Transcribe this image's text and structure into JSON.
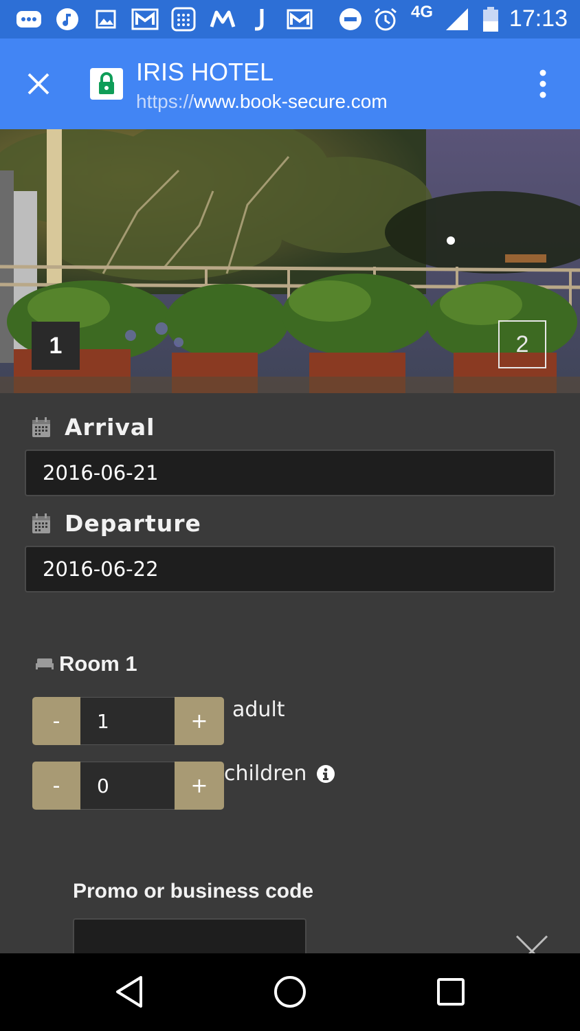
{
  "status_bar": {
    "time": "17:13",
    "network": "4G",
    "icons": [
      "messages-icon",
      "music-icon",
      "gallery-icon",
      "gmail-icon",
      "calculator-icon",
      "m-app-icon",
      "j-app-icon",
      "email-icon",
      "do-not-disturb-icon",
      "alarm-icon",
      "signal-icon",
      "battery-icon"
    ]
  },
  "toolbar": {
    "title": "IRIS HOTEL",
    "url_scheme": "https://",
    "url_host": "www.book-secure.com"
  },
  "gallery": {
    "current_slide": "1",
    "next_slide": "2"
  },
  "form": {
    "arrival_label": "Arrival",
    "arrival_value": "2016-06-21",
    "departure_label": "Departure",
    "departure_value": "2016-06-22",
    "room_label": "Room 1",
    "adult_value": "1",
    "adult_label": "adult",
    "children_value": "0",
    "children_label": "children",
    "minus_label": "-",
    "plus_label": "+",
    "promo_label": "Promo or business code"
  },
  "colors": {
    "status_bar": "#2d6fd6",
    "toolbar": "#4285f4",
    "form_bg": "#3a3a3a",
    "stepper_button": "#a89a74",
    "input_bg": "#1e1e1e",
    "lock_green": "#0f9d58"
  }
}
